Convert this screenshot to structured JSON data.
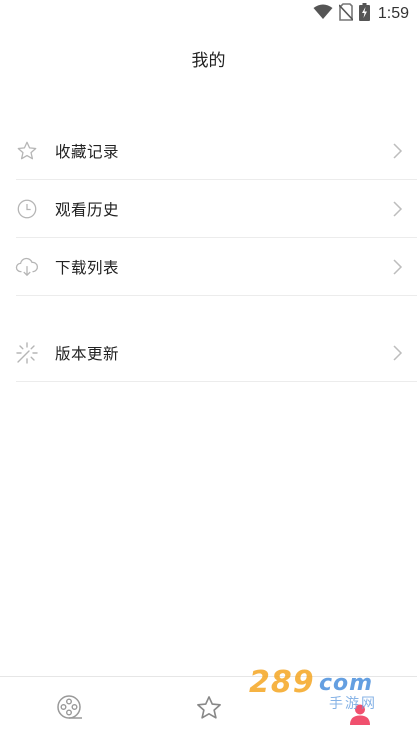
{
  "status_bar": {
    "time": "1:59",
    "icons": [
      "wifi-icon",
      "no-sim-icon",
      "battery-charging-icon"
    ]
  },
  "header": {
    "title": "我的"
  },
  "menu_group_1": [
    {
      "label": "收藏记录",
      "icon": "star-outline-icon"
    },
    {
      "label": "观看历史",
      "icon": "clock-icon"
    },
    {
      "label": "下载列表",
      "icon": "cloud-download-icon"
    }
  ],
  "menu_group_2": [
    {
      "label": "版本更新",
      "icon": "sparkle-update-icon"
    }
  ],
  "bottom_nav": {
    "items": [
      {
        "icon": "film-reel-icon",
        "active": false
      },
      {
        "icon": "star-outline-icon",
        "active": false
      },
      {
        "icon": "user-icon",
        "active": true
      }
    ]
  },
  "watermark": {
    "text": "289",
    "suffix": "com",
    "sub": "手游网"
  },
  "colors": {
    "accent": "#f0506e",
    "icon_gray": "#b5b5b5",
    "divider": "#ececec"
  }
}
